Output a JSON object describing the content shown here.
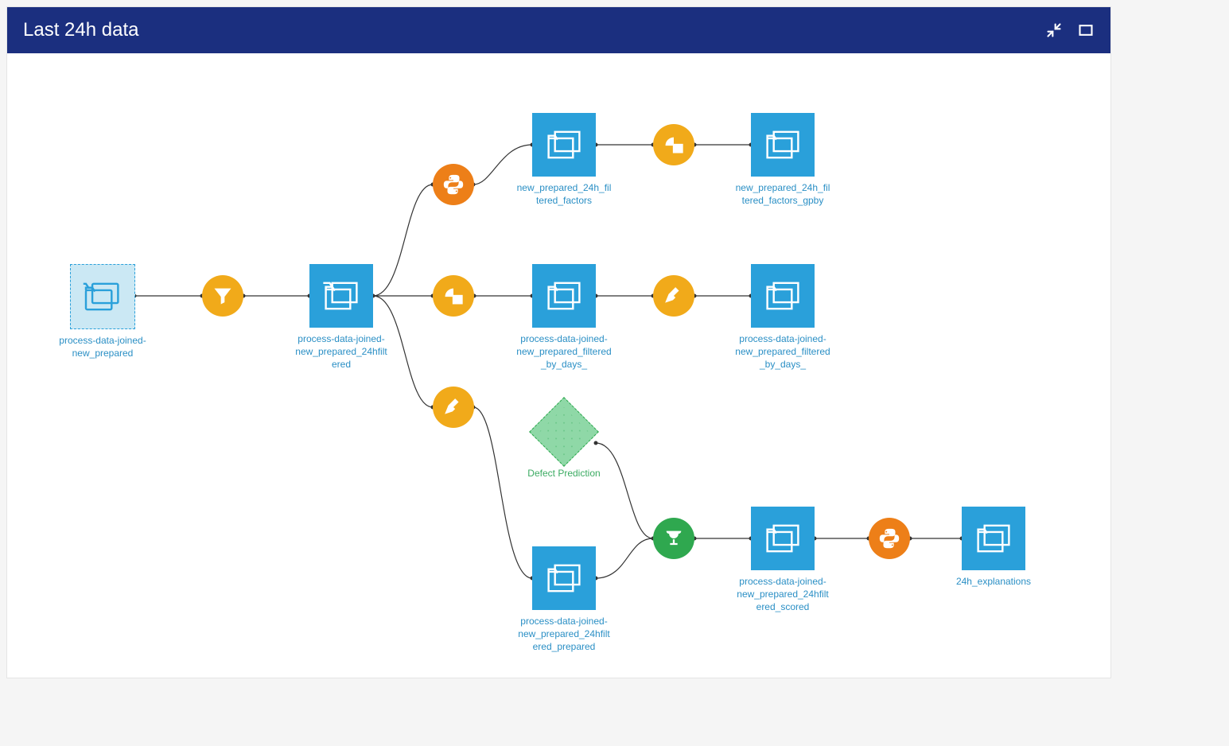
{
  "panel": {
    "title": "Last 24h data"
  },
  "colors": {
    "panel_header": "#1b2f7f",
    "dataset_blue": "#2aa0da",
    "recipe_yellow": "#f1aa1a",
    "recipe_orange": "#ed7f18",
    "recipe_green": "#2fa84f",
    "model_green": "#8fd8a7",
    "label_blue": "#2a8fc5",
    "label_green": "#3bab62"
  },
  "datasets": {
    "d1": {
      "label": "process-data-joined-new_prepared",
      "style": "dashed"
    },
    "d2": {
      "label": "process-data-joined-new_prepared_24hfiltered"
    },
    "d3": {
      "label": "new_prepared_24h_filtered_factors"
    },
    "d4": {
      "label": "new_prepared_24h_filtered_factors_gpby"
    },
    "d5": {
      "label": "process-data-joined-new_prepared_filtered_by_days_"
    },
    "d6": {
      "label": "process-data-joined-new_prepared_filtered_by_days_"
    },
    "d7": {
      "label": "process-data-joined-new_prepared_24hfiltered_prepared"
    },
    "d8": {
      "label": "process-data-joined-new_prepared_24hfiltered_scored"
    },
    "d9": {
      "label": "24h_explanations"
    }
  },
  "models": {
    "m1": {
      "label": "Defect Prediction"
    }
  },
  "recipes": {
    "r1": {
      "type": "filter",
      "color": "yellow"
    },
    "r2": {
      "type": "python",
      "color": "orange"
    },
    "r3": {
      "type": "group",
      "color": "yellow"
    },
    "r4": {
      "type": "group",
      "color": "yellow"
    },
    "r5": {
      "type": "prepare",
      "color": "yellow"
    },
    "r6": {
      "type": "prepare",
      "color": "yellow"
    },
    "r7": {
      "type": "score",
      "color": "green"
    },
    "r8": {
      "type": "python",
      "color": "orange"
    }
  },
  "edges": [
    [
      "d1",
      "r1"
    ],
    [
      "r1",
      "d2"
    ],
    [
      "d2",
      "r2"
    ],
    [
      "r2",
      "d3"
    ],
    [
      "d3",
      "r3"
    ],
    [
      "r3",
      "d4"
    ],
    [
      "d2",
      "r4"
    ],
    [
      "r4",
      "d5"
    ],
    [
      "d5",
      "r5"
    ],
    [
      "r5",
      "d6"
    ],
    [
      "d2",
      "r6"
    ],
    [
      "r6",
      "d7"
    ],
    [
      "d7",
      "r7"
    ],
    [
      "m1",
      "r7"
    ],
    [
      "r7",
      "d8"
    ],
    [
      "d8",
      "r8"
    ],
    [
      "r8",
      "d9"
    ]
  ]
}
